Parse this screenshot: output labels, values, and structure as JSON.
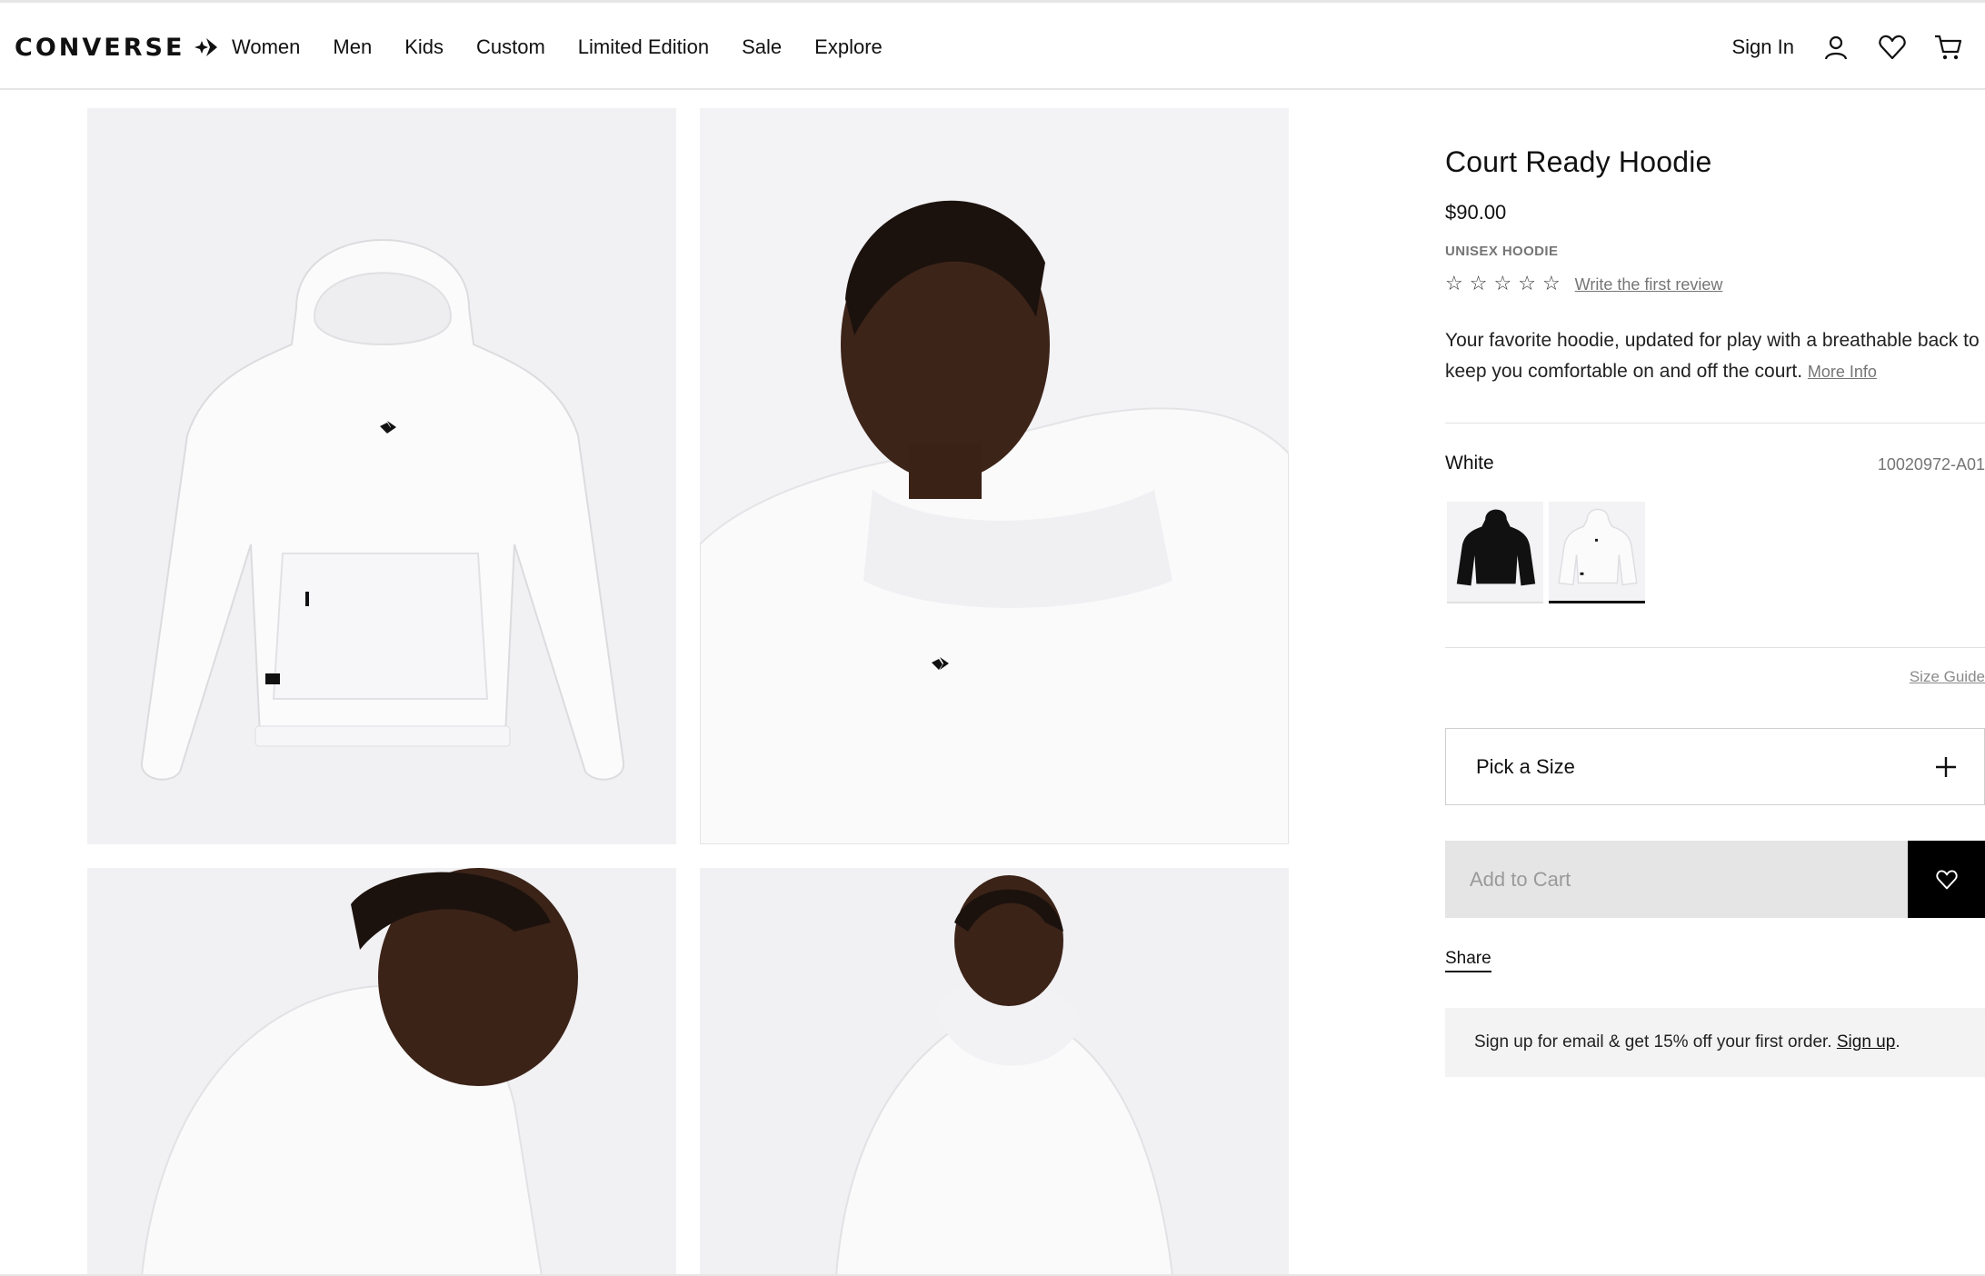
{
  "header": {
    "logo_text": "CONVERSE",
    "nav": [
      "Women",
      "Men",
      "Kids",
      "Custom",
      "Limited Edition",
      "Sale",
      "Explore"
    ],
    "sign_in": "Sign In",
    "icons": [
      "user-icon",
      "heart-icon",
      "cart-icon"
    ]
  },
  "gallery": {
    "images": [
      "hoodie-flat-front",
      "model-front-portrait",
      "model-side-profile",
      "model-back-view"
    ]
  },
  "product": {
    "title": "Court Ready Hoodie",
    "price": "$90.00",
    "category": "UNISEX HOODIE",
    "rating": 0,
    "review_link": "Write the first review",
    "description": "Your favorite hoodie, updated for play with a breathable back to keep you comfortable on and off the court.",
    "more_info": "More Info",
    "color_name": "White",
    "style_code": "10020972-A01",
    "swatches": [
      {
        "color": "Black",
        "hex": "#111111",
        "selected": false
      },
      {
        "color": "White",
        "hex": "#f5f5f7",
        "selected": true
      }
    ],
    "size_guide": "Size Guide",
    "size_picker_label": "Pick a Size",
    "add_to_cart": "Add to Cart",
    "share": "Share"
  },
  "promo": {
    "text": "Sign up for email & get 15% off your first order.",
    "link": "Sign up",
    "suffix": "."
  },
  "colors": {
    "accent": "#000000",
    "muted_text": "#757575",
    "disabled_button": "#e5e5e5"
  }
}
